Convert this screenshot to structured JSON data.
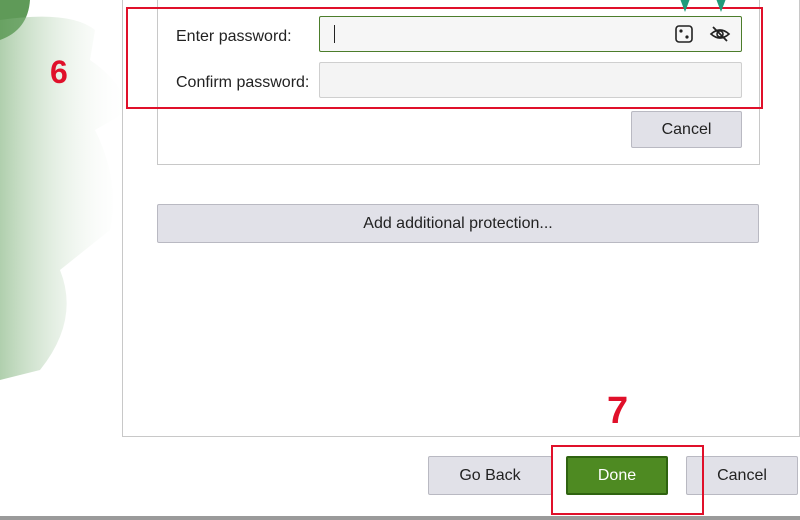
{
  "password_form": {
    "enter_label": "Enter password:",
    "confirm_label": "Confirm password:",
    "enter_value": "",
    "confirm_value": "",
    "generate_icon": "dice-icon",
    "visibility_icon": "eye-slash-icon",
    "cancel_label": "Cancel"
  },
  "protection": {
    "add_label": "Add additional protection..."
  },
  "footer": {
    "go_back_label": "Go Back",
    "done_label": "Done",
    "cancel_label": "Cancel"
  },
  "annotations": {
    "step6": "6",
    "step7": "7"
  },
  "colors": {
    "accent": "#4e8a22",
    "annotation_red": "#e0102a",
    "pin_teal": "#1e9a7a"
  }
}
